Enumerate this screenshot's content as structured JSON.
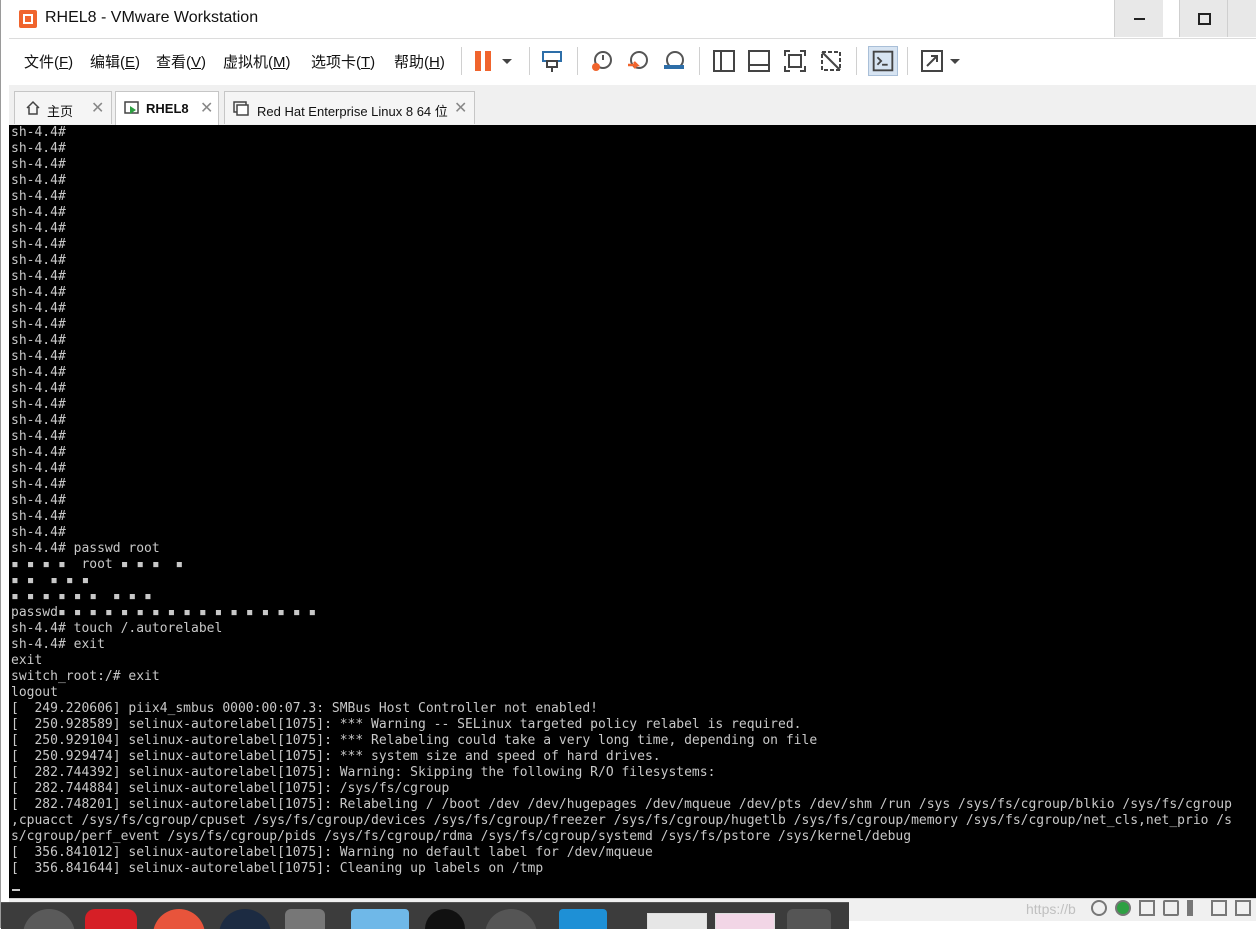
{
  "window": {
    "title": "RHEL8 - VMware Workstation"
  },
  "menu": [
    {
      "label": "文件(",
      "key": "F",
      "end": ")"
    },
    {
      "label": "编辑(",
      "key": "E",
      "end": ")"
    },
    {
      "label": "查看(",
      "key": "V",
      "end": ")"
    },
    {
      "label": "虚拟机(",
      "key": "M",
      "end": ")"
    },
    {
      "label": "选项卡(",
      "key": "T",
      "end": ")"
    },
    {
      "label": "帮助(",
      "key": "H",
      "end": ")"
    }
  ],
  "toolbar": {
    "icons": [
      "pause-icon",
      "dropdown-arrow-icon",
      "send-ctrl-alt-del-icon",
      "snapshot-take-icon",
      "snapshot-revert-icon",
      "snapshot-manager-icon",
      "sidebar-toggle-icon",
      "thumbnail-bar-icon",
      "fullscreen-icon",
      "unity-icon",
      "console-view-icon",
      "stretch-icon",
      "stretch-dropdown-icon"
    ]
  },
  "tabs": [
    {
      "label": "主页",
      "icon": "home-icon",
      "active": false
    },
    {
      "label": "RHEL8",
      "icon": "vm-running-icon",
      "active": true
    },
    {
      "label": "Red Hat Enterprise Linux 8 64 位",
      "icon": "vm-icon",
      "active": false
    }
  ],
  "console": {
    "lines": [
      "sh-4.4#",
      "sh-4.4#",
      "sh-4.4#",
      "sh-4.4#",
      "sh-4.4#",
      "sh-4.4#",
      "sh-4.4#",
      "sh-4.4#",
      "sh-4.4#",
      "sh-4.4#",
      "sh-4.4#",
      "sh-4.4#",
      "sh-4.4#",
      "sh-4.4#",
      "sh-4.4#",
      "sh-4.4#",
      "sh-4.4#",
      "sh-4.4#",
      "sh-4.4#",
      "sh-4.4#",
      "sh-4.4#",
      "sh-4.4#",
      "sh-4.4#",
      "sh-4.4#",
      "sh-4.4#",
      "sh-4.4#",
      "sh-4.4# passwd root",
      "▪ ▪ ▪ ▪  root ▪ ▪ ▪  ▪",
      "▪ ▪  ▪ ▪ ▪",
      "▪ ▪ ▪ ▪ ▪ ▪  ▪ ▪ ▪",
      "passwd▪ ▪ ▪ ▪ ▪ ▪ ▪ ▪ ▪ ▪ ▪ ▪ ▪ ▪ ▪ ▪ ▪",
      "sh-4.4# touch /.autorelabel",
      "sh-4.4# exit",
      "exit",
      "switch_root:/# exit",
      "logout",
      "[  249.220606] piix4_smbus 0000:00:07.3: SMBus Host Controller not enabled!",
      "[  250.928589] selinux-autorelabel[1075]: *** Warning -- SELinux targeted policy relabel is required.",
      "[  250.929104] selinux-autorelabel[1075]: *** Relabeling could take a very long time, depending on file",
      "[  250.929474] selinux-autorelabel[1075]: *** system size and speed of hard drives.",
      "[  282.744392] selinux-autorelabel[1075]: Warning: Skipping the following R/O filesystems:",
      "[  282.744884] selinux-autorelabel[1075]: /sys/fs/cgroup",
      "[  282.748201] selinux-autorelabel[1075]: Relabeling / /boot /dev /dev/hugepages /dev/mqueue /dev/pts /dev/shm /run /sys /sys/fs/cgroup/blkio /sys/fs/cgroup",
      ",cpuacct /sys/fs/cgroup/cpuset /sys/fs/cgroup/devices /sys/fs/cgroup/freezer /sys/fs/cgroup/hugetlb /sys/fs/cgroup/memory /sys/fs/cgroup/net_cls,net_prio /s",
      "s/cgroup/perf_event /sys/fs/cgroup/pids /sys/fs/cgroup/rdma /sys/fs/cgroup/systemd /sys/fs/pstore /sys/kernel/debug",
      "[  356.841012] selinux-autorelabel[1075]: Warning no default label for /dev/mqueue",
      "[  356.841644] selinux-autorelabel[1075]: Cleaning up labels on /tmp"
    ]
  },
  "statusbar": {
    "watermark": "https://b"
  },
  "colors": {
    "accent_orange": "#f0642d",
    "console_bg": "#000000",
    "console_fg": "#c8c8c8"
  }
}
